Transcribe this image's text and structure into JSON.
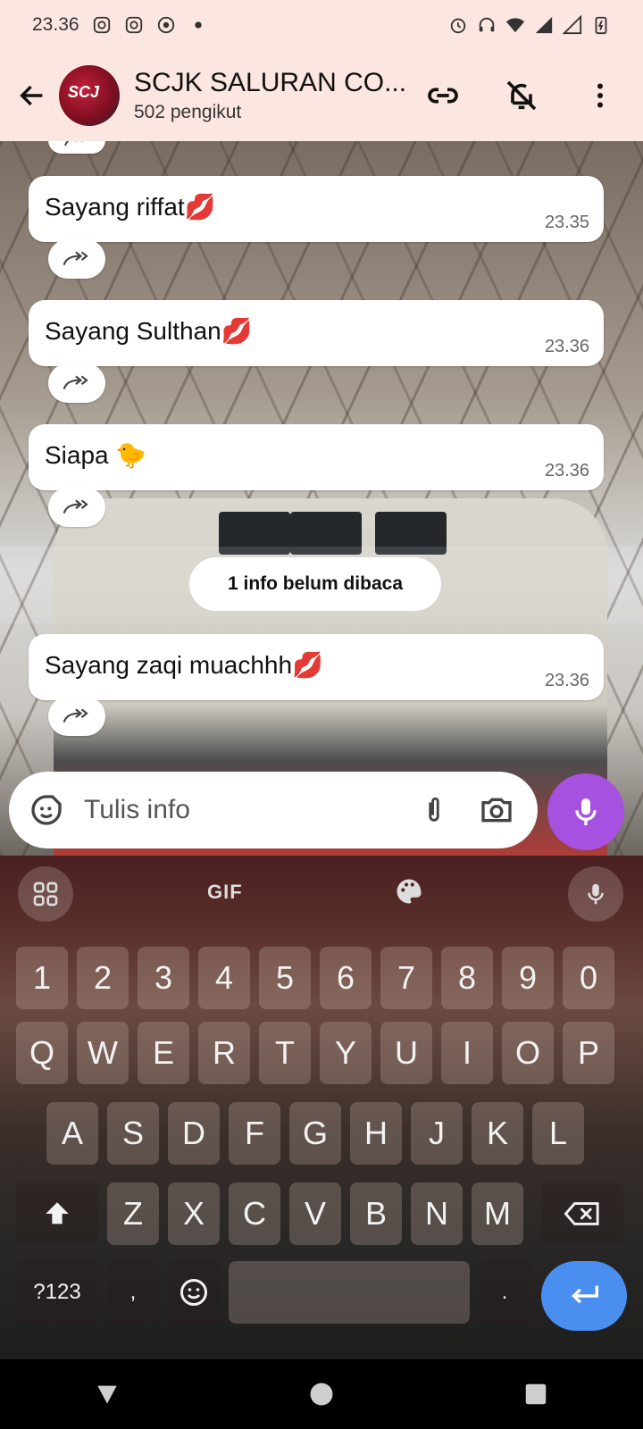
{
  "status_bar": {
    "time": "23.36"
  },
  "header": {
    "title": "SCJK SALURAN CO...",
    "subtitle": "502 pengikut"
  },
  "messages": [
    {
      "text": "Sayang riffat💋",
      "time": "23.35"
    },
    {
      "text": "Sayang Sulthan💋",
      "time": "23.36"
    },
    {
      "text": "Siapa 🐤",
      "time": "23.36"
    },
    {
      "text": "Sayang zaqi muachhh💋",
      "time": "23.36"
    }
  ],
  "unread_label": "1 info belum dibaca",
  "composer": {
    "placeholder": "Tulis info"
  },
  "keyboard": {
    "top": {
      "gif_label": "GIF"
    },
    "numbers": [
      "1",
      "2",
      "3",
      "4",
      "5",
      "6",
      "7",
      "8",
      "9",
      "0"
    ],
    "row1": [
      "Q",
      "W",
      "E",
      "R",
      "T",
      "Y",
      "U",
      "I",
      "O",
      "P"
    ],
    "row2": [
      "A",
      "S",
      "D",
      "F",
      "G",
      "H",
      "J",
      "K",
      "L"
    ],
    "row3": [
      "Z",
      "X",
      "C",
      "V",
      "B",
      "N",
      "M"
    ],
    "symbols_label": "?123",
    "comma": ",",
    "period": "."
  },
  "colors": {
    "header_bg": "#fce6e2",
    "mic_fab": "#a651e0",
    "enter_key": "#4a8ff0"
  }
}
